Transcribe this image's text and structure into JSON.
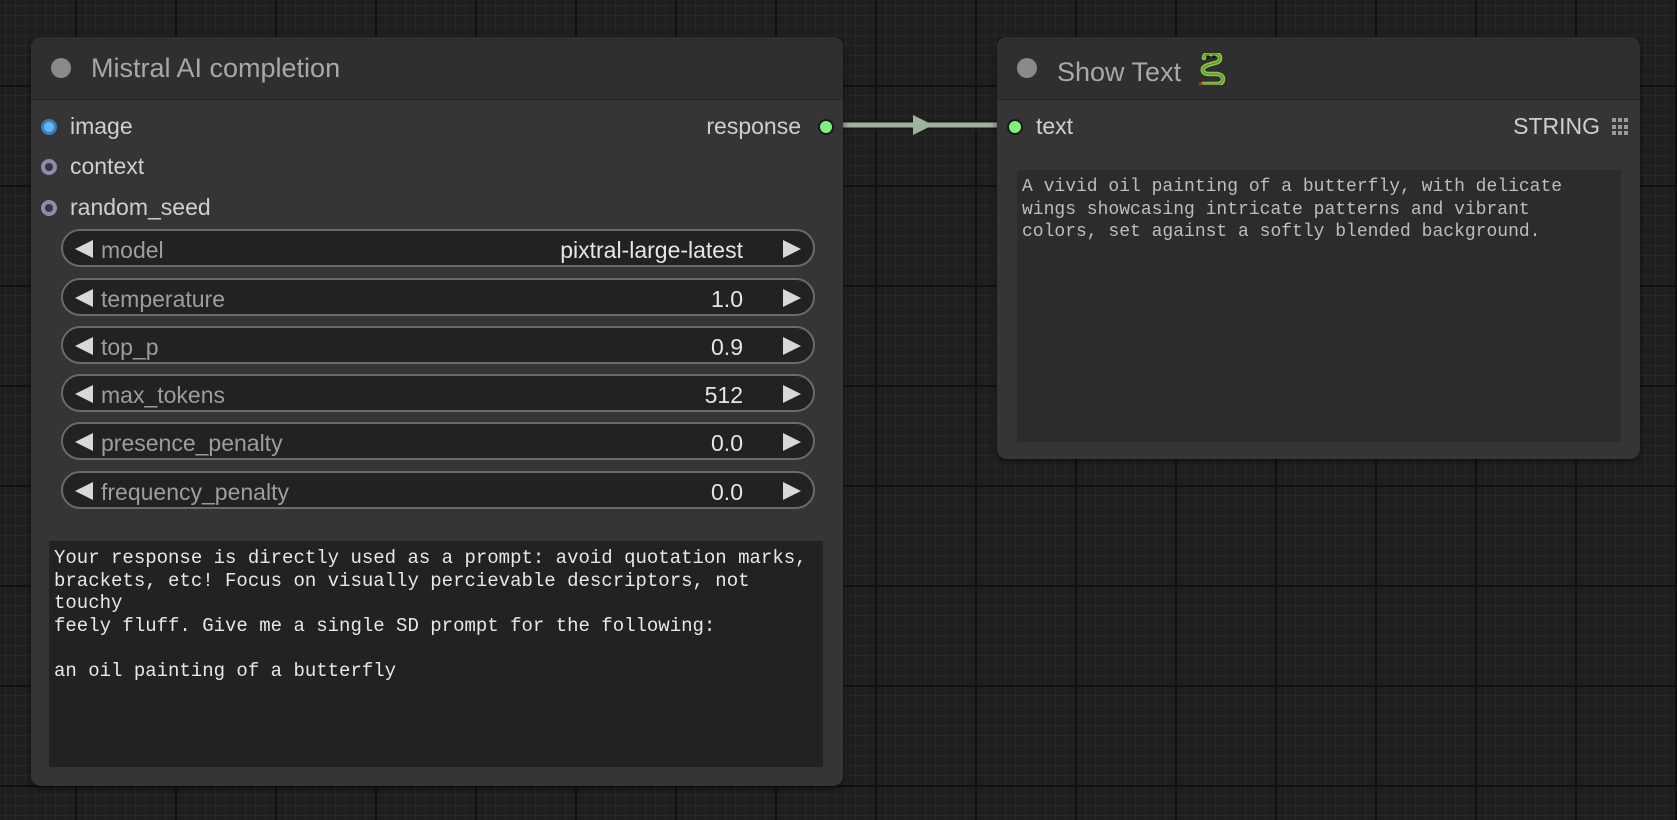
{
  "mistral_node": {
    "title": "Mistral AI completion",
    "inputs": [
      {
        "label": "image",
        "color": "#64b5f6"
      },
      {
        "label": "context",
        "color": "#9a9ab5"
      },
      {
        "label": "random_seed",
        "color": "#9a9ab5"
      }
    ],
    "output_label": "response",
    "output_color": "#7cf27c",
    "widgets": [
      {
        "label": "model",
        "value": "pixtral-large-latest"
      },
      {
        "label": "temperature",
        "value": "1.0"
      },
      {
        "label": "top_p",
        "value": "0.9"
      },
      {
        "label": "max_tokens",
        "value": "512"
      },
      {
        "label": "presence_penalty",
        "value": "0.0"
      },
      {
        "label": "frequency_penalty",
        "value": "0.0"
      }
    ],
    "prompt_text": "Your response is directly used as a prompt: avoid quotation marks,\nbrackets, etc! Focus on visually percievable descriptors, not touchy\nfeely fluff. Give me a single SD prompt for the following:\n\nan oil painting of a butterfly"
  },
  "show_text_node": {
    "title": "Show Text",
    "title_icon": "snake-icon",
    "input_label": "text",
    "input_color": "#7cf27c",
    "type_label": "STRING",
    "type_icon": "grid-icon",
    "output_text": "A vivid oil painting of a butterfly, with delicate\nwings showcasing intricate patterns and vibrant\ncolors, set against a softly blended background."
  },
  "link_color": "#9fb49f"
}
